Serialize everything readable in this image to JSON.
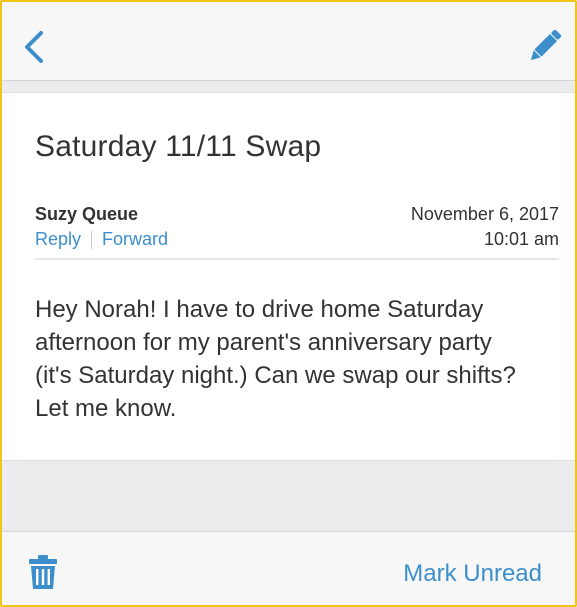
{
  "header": {
    "back_icon": "chevron-left-icon",
    "edit_icon": "pencil-icon"
  },
  "message": {
    "subject": "Saturday 11/11 Swap",
    "sender": "Suzy Queue",
    "actions": {
      "reply": "Reply",
      "forward": "Forward"
    },
    "date": "November 6, 2017",
    "time": "10:01 am",
    "body": "Hey Norah! I have to drive home Saturday\nafternoon for my parent's anniversary party\n(it's Saturday night.) Can we swap our shifts?\nLet me know."
  },
  "footer": {
    "trash_icon": "trash-icon",
    "mark_unread": "Mark Unread"
  },
  "colors": {
    "accent": "#3d8fcc",
    "text": "#333333",
    "bar_bg": "#f7f7f8",
    "frame_border": "#f0c419"
  }
}
